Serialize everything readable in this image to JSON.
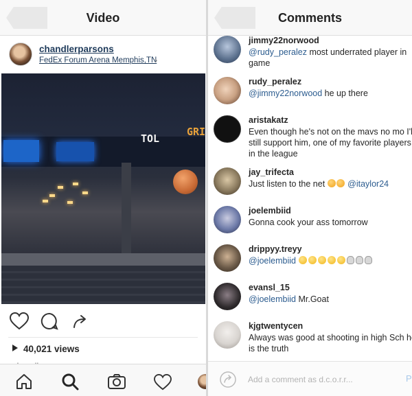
{
  "left": {
    "title": "Video",
    "post": {
      "username": "chandlerparsons",
      "location": "FedEx Forum Arena Memphis,TN",
      "views": "40,021 views",
      "caption_cut": "chandlerparsons"
    },
    "video": {
      "sign_text": "TOL",
      "sign_text2": "GRI"
    },
    "tabs": [
      "home",
      "search",
      "camera",
      "activity",
      "profile"
    ]
  },
  "right": {
    "title": "Comments",
    "comments": [
      {
        "user": "jimmy22norwood",
        "mention": "@rudy_peralez",
        "text": " most underrated player in game",
        "avatar_color": "#5a6f8c"
      },
      {
        "user": "rudy_peralez",
        "mention": "@jimmy22norwood",
        "text": " he up there",
        "avatar_color": "#c9a183"
      },
      {
        "user": "aristakatz",
        "mention": "",
        "text": "Even though he's not on the mavs no mo I'll still support him, one of my favorite players in the league",
        "avatar_color": "#1a1a1a"
      },
      {
        "user": "jay_trifecta",
        "mention": "",
        "text": "Just listen to the net",
        "mention2": "@itaylor24",
        "avatar_color": "#8a7a5e"
      },
      {
        "user": "joelembiid",
        "mention": "",
        "text": "Gonna cook your ass tomorrow",
        "avatar_color": "#6d7aa8"
      },
      {
        "user": "drippyy.treyy",
        "mention": "@joelembiid",
        "text": "",
        "avatar_color": "#6b5a48"
      },
      {
        "user": "evansl_15",
        "mention": "@joelembiid",
        "text": " Mr.Goat",
        "avatar_color": "#2e2a2c"
      },
      {
        "user": "kjgtwentycen",
        "mention": "",
        "text": "Always was good at shooting in high Sch he is the truth",
        "avatar_color": "#d8d4d0"
      }
    ],
    "input_placeholder": "Add a comment as d.c.o.r.r...",
    "post_label": "P"
  }
}
